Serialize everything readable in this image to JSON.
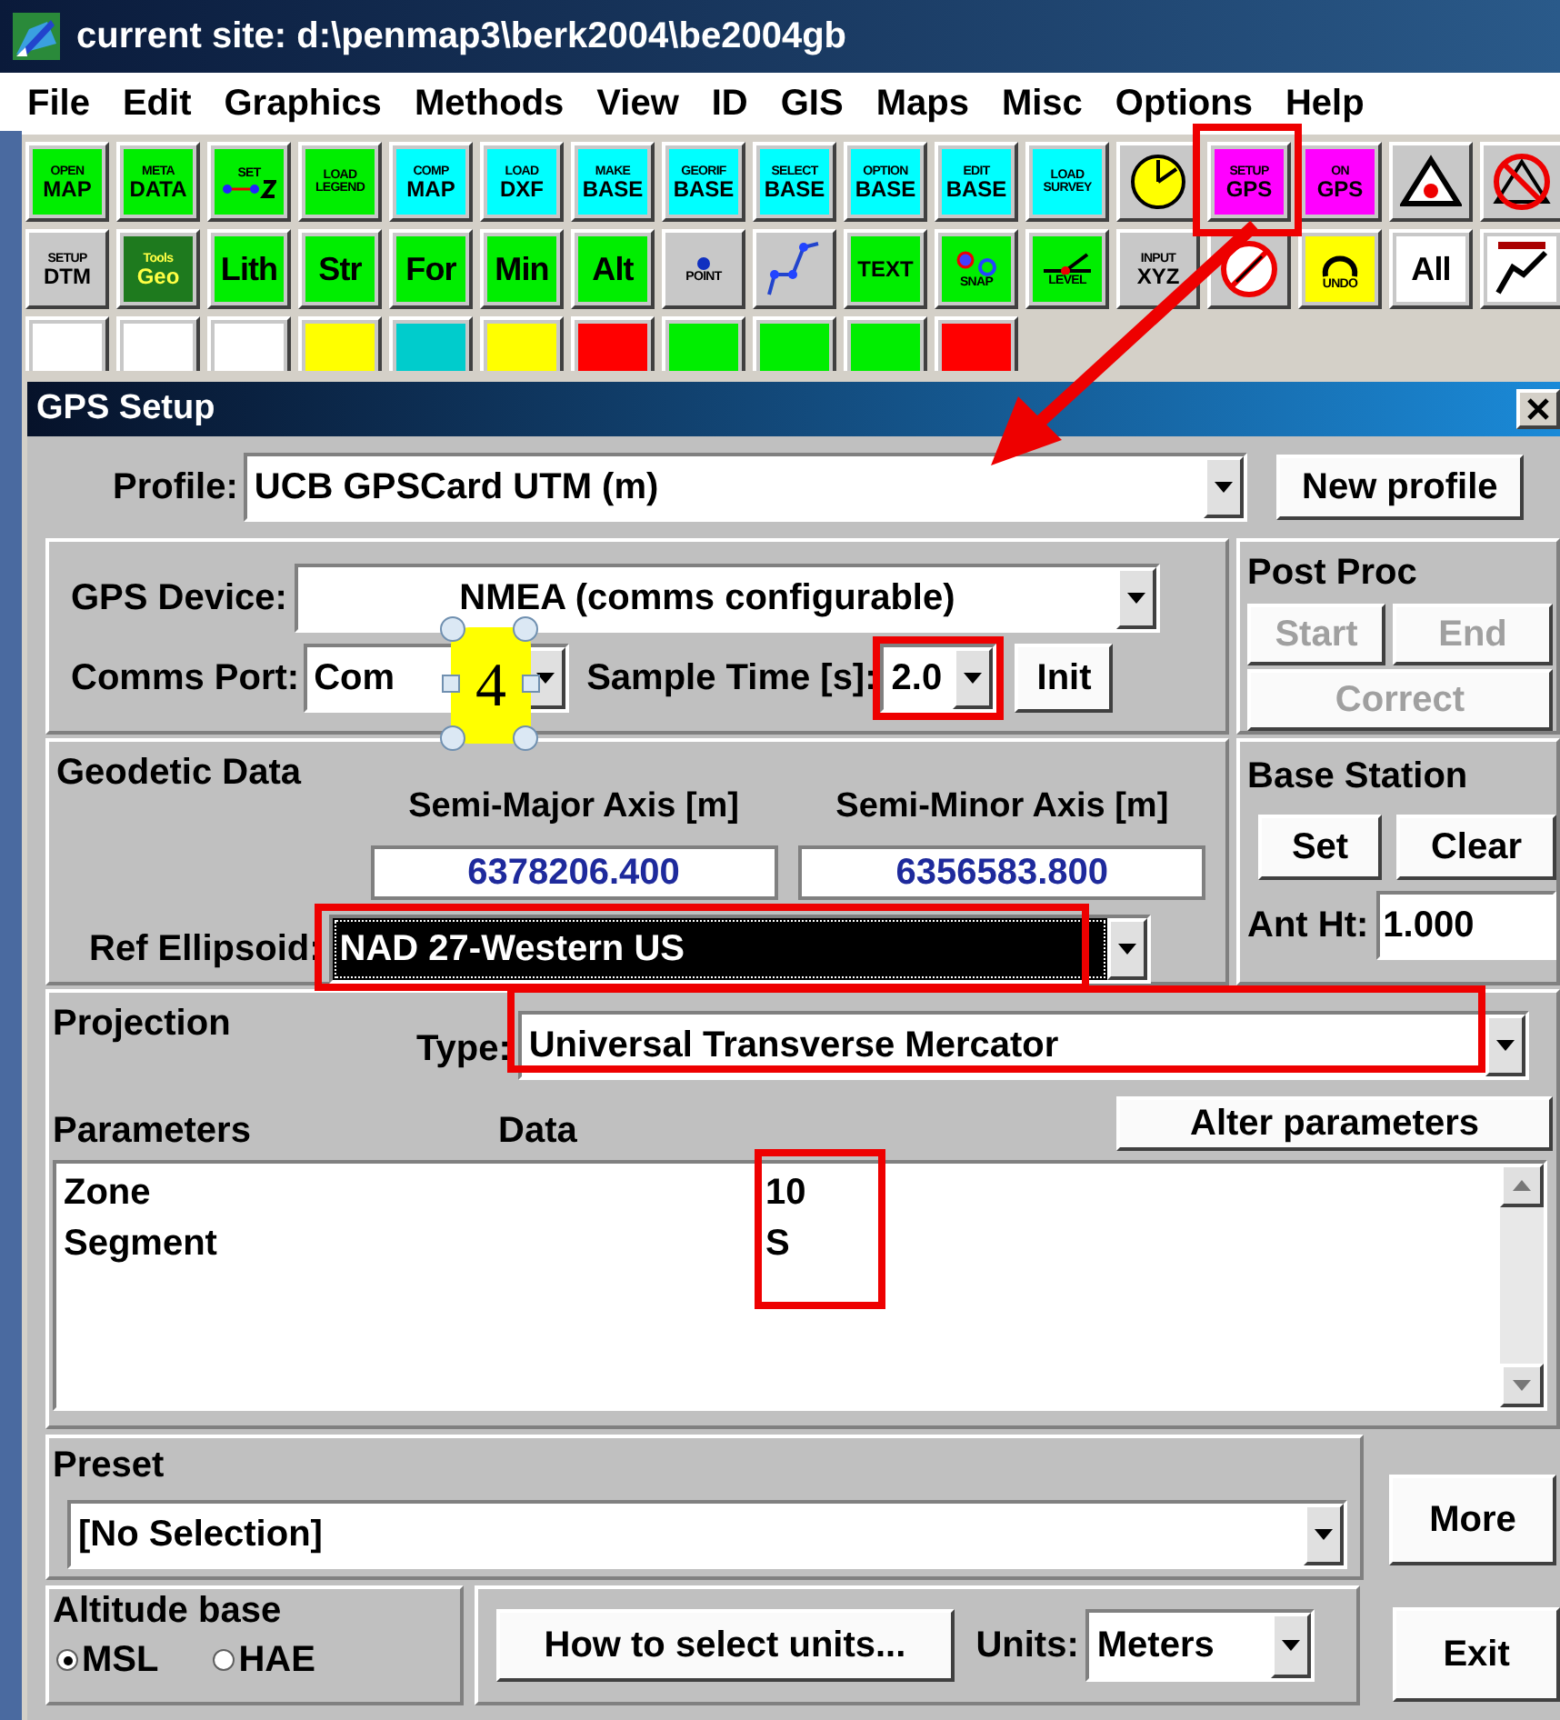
{
  "window": {
    "title": "current site: d:\\penmap3\\berk2004\\be2004gb"
  },
  "menu": [
    {
      "label": "File"
    },
    {
      "label": "Edit"
    },
    {
      "label": "Graphics"
    },
    {
      "label": "Methods"
    },
    {
      "label": "View"
    },
    {
      "label": "ID"
    },
    {
      "label": "GIS"
    },
    {
      "label": "Maps"
    },
    {
      "label": "Misc"
    },
    {
      "label": "Options"
    },
    {
      "label": "Help"
    }
  ],
  "toolbar_rows": [
    [
      {
        "kind": "text",
        "lines": [
          "OPEN",
          "MAP"
        ],
        "color": "#00ee00"
      },
      {
        "kind": "text",
        "lines": [
          "META",
          "DATA"
        ],
        "color": "#00ee00"
      },
      {
        "kind": "setz",
        "lines": [
          "SET"
        ],
        "color": "#00ee00"
      },
      {
        "kind": "text",
        "lines": [
          "LOAD",
          "LEGEND"
        ],
        "color": "#00ee00"
      },
      {
        "kind": "text",
        "lines": [
          "COMP",
          "MAP"
        ],
        "color": "#00ffff"
      },
      {
        "kind": "text",
        "lines": [
          "LOAD",
          "DXF"
        ],
        "color": "#00ffff"
      },
      {
        "kind": "text",
        "lines": [
          "MAKE",
          "BASE"
        ],
        "color": "#00ffff"
      },
      {
        "kind": "text",
        "lines": [
          "GEORIF",
          "BASE"
        ],
        "color": "#00ffff"
      },
      {
        "kind": "text",
        "lines": [
          "SELECT",
          "BASE"
        ],
        "color": "#00ffff"
      },
      {
        "kind": "text",
        "lines": [
          "OPTION",
          "BASE"
        ],
        "color": "#00ffff"
      },
      {
        "kind": "text",
        "lines": [
          "EDIT",
          "BASE"
        ],
        "color": "#00ffff"
      },
      {
        "kind": "text",
        "lines": [
          "LOAD",
          "SURVEY"
        ],
        "color": "#00ffff"
      },
      {
        "kind": "clock",
        "color": "#c8c8c8"
      },
      {
        "kind": "text",
        "lines": [
          "SETUP",
          "GPS"
        ],
        "color": "#ff00ff",
        "highlighted": true
      },
      {
        "kind": "text",
        "lines": [
          "ON",
          "GPS"
        ],
        "color": "#ff00ff"
      },
      {
        "kind": "triangle",
        "color": "#c8c8c8"
      },
      {
        "kind": "no-triangle",
        "color": "#c8c8c8"
      }
    ],
    [
      {
        "kind": "text",
        "lines": [
          "SETUP",
          "DTM"
        ],
        "color": "#c8c8c8"
      },
      {
        "kind": "text",
        "lines": [
          "Tools",
          "Geo"
        ],
        "color": "#1e7a1e"
      },
      {
        "kind": "big",
        "lines": [
          "Lith"
        ],
        "color": "#00ee00"
      },
      {
        "kind": "big",
        "lines": [
          "Str"
        ],
        "color": "#00ee00"
      },
      {
        "kind": "big",
        "lines": [
          "For"
        ],
        "color": "#00ee00"
      },
      {
        "kind": "big",
        "lines": [
          "Min"
        ],
        "color": "#00ee00"
      },
      {
        "kind": "big",
        "lines": [
          "Alt"
        ],
        "color": "#00ee00"
      },
      {
        "kind": "point",
        "lines": [
          "POINT"
        ],
        "color": "#c8c8c8"
      },
      {
        "kind": "polyline",
        "color": "#c8c8c8"
      },
      {
        "kind": "text",
        "lines": [
          "TEXT"
        ],
        "color": "#00ee00"
      },
      {
        "kind": "snap",
        "lines": [
          "SNAP"
        ],
        "color": "#00ee00"
      },
      {
        "kind": "level",
        "lines": [
          "LEVEL"
        ],
        "color": "#00ee00"
      },
      {
        "kind": "text",
        "lines": [
          "INPUT",
          "XYZ"
        ],
        "color": "#c8c8c8"
      },
      {
        "kind": "no-sign",
        "color": "#c8c8c8"
      },
      {
        "kind": "undo",
        "lines": [
          "UNDO"
        ],
        "color": "#ffff00"
      },
      {
        "kind": "big",
        "lines": [
          "All"
        ],
        "color": "#ffffff"
      },
      {
        "kind": "line",
        "color": "#ffffff"
      }
    ],
    [
      {
        "kind": "blank",
        "color": "#ffffff"
      },
      {
        "kind": "blank",
        "color": "#ffffff"
      },
      {
        "kind": "blank",
        "color": "#ffffff"
      },
      {
        "kind": "blank",
        "color": "#ffff00"
      },
      {
        "kind": "blank",
        "color": "#00cccc"
      },
      {
        "kind": "blank",
        "color": "#ffff00"
      },
      {
        "kind": "blank",
        "color": "#ff0000"
      },
      {
        "kind": "blank",
        "color": "#00ee00"
      },
      {
        "kind": "blank",
        "color": "#00ee00"
      },
      {
        "kind": "blank",
        "color": "#00ee00"
      },
      {
        "kind": "blank",
        "color": "#ff0000"
      }
    ]
  ],
  "dialog": {
    "title": "GPS Setup",
    "profile": {
      "label": "Profile:",
      "value": "UCB GPSCard UTM (m)"
    },
    "new_profile_button": "New profile",
    "gps_device": {
      "label": "GPS Device:",
      "value": "NMEA (comms configurable)"
    },
    "comms_port": {
      "label": "Comms Port:",
      "value": "Com"
    },
    "sample_time": {
      "label": "Sample Time [s]:",
      "value": "2.0",
      "highlighted": true
    },
    "init_button": "Init",
    "post_proc": {
      "title": "Post Proc",
      "buttons": [
        {
          "label": "Start",
          "disabled": true
        },
        {
          "label": "End",
          "disabled": true
        },
        {
          "label": "Correct",
          "disabled": true
        }
      ]
    },
    "geodetic_data": {
      "title": "Geodetic Data",
      "semi_major": {
        "label": "Semi-Major Axis [m]",
        "value": "6378206.400"
      },
      "semi_minor": {
        "label": "Semi-Minor Axis [m]",
        "value": "6356583.800"
      },
      "ref_ellipsoid": {
        "label": "Ref Ellipsoid:",
        "value": "NAD 27-Western US",
        "selected": true,
        "highlighted": true
      }
    },
    "base_station": {
      "title": "Base Station",
      "buttons": [
        "Set",
        "Clear"
      ],
      "ant_ht": {
        "label": "Ant Ht:",
        "value": "1.000"
      }
    },
    "projection": {
      "title": "Projection",
      "type": {
        "label": "Type:",
        "value": "Universal Transverse Mercator",
        "highlighted": true
      },
      "alter_button": "Alter parameters",
      "columns": [
        "Parameters",
        "Data"
      ],
      "data_highlighted": true,
      "rows": [
        {
          "parameter": "Zone",
          "data": "10"
        },
        {
          "parameter": "Segment",
          "data": "S"
        }
      ]
    },
    "preset": {
      "title": "Preset",
      "value": "[No Selection]"
    },
    "more_button": "More",
    "altitude_base": {
      "title": "Altitude base",
      "options": [
        {
          "label": "MSL",
          "selected": true
        },
        {
          "label": "HAE",
          "selected": false
        }
      ]
    },
    "units_button": "How to select units...",
    "units": {
      "label": "Units:",
      "value": "Meters"
    },
    "exit_button": "Exit",
    "callout": {
      "label": "4"
    }
  }
}
